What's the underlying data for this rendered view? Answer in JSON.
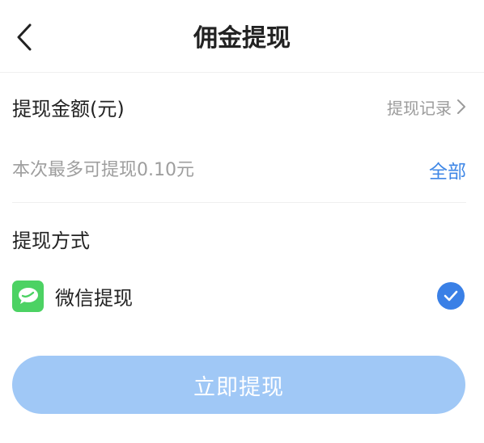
{
  "header": {
    "title": "佣金提现",
    "back_icon": "chevron-left-icon"
  },
  "amount": {
    "label": "提现金额(元)",
    "record_link": "提现记录",
    "input_placeholder": "本次最多可提现0.10元",
    "input_value": "",
    "all_button": "全部"
  },
  "method": {
    "title": "提现方式",
    "options": [
      {
        "label": "微信提现",
        "icon": "wechat-icon",
        "selected": true
      }
    ]
  },
  "submit": {
    "label": "立即提现",
    "enabled": false
  },
  "colors": {
    "accent": "#3f87e6",
    "submit_disabled": "#a0c8f6",
    "wechat_green": "#4cd263"
  }
}
